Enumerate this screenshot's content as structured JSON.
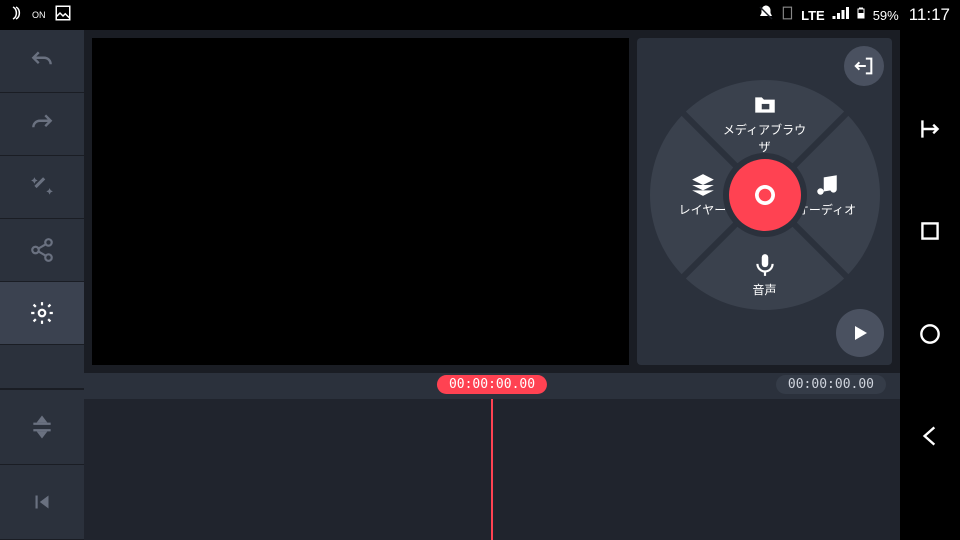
{
  "status_bar": {
    "nfc": "ON",
    "network": "LTE",
    "battery": "59%",
    "time": "11:17"
  },
  "wheel": {
    "media": "メディアブラウザ",
    "layer": "レイヤー",
    "audio": "オーディオ",
    "voice": "音声"
  },
  "timeline": {
    "playhead": "00:00:00.00",
    "total": "00:00:00.00"
  },
  "icons": {
    "undo": "undo",
    "redo": "redo",
    "magic": "magic",
    "share": "share",
    "settings": "settings",
    "split": "split",
    "skip_prev": "skip-prev"
  }
}
